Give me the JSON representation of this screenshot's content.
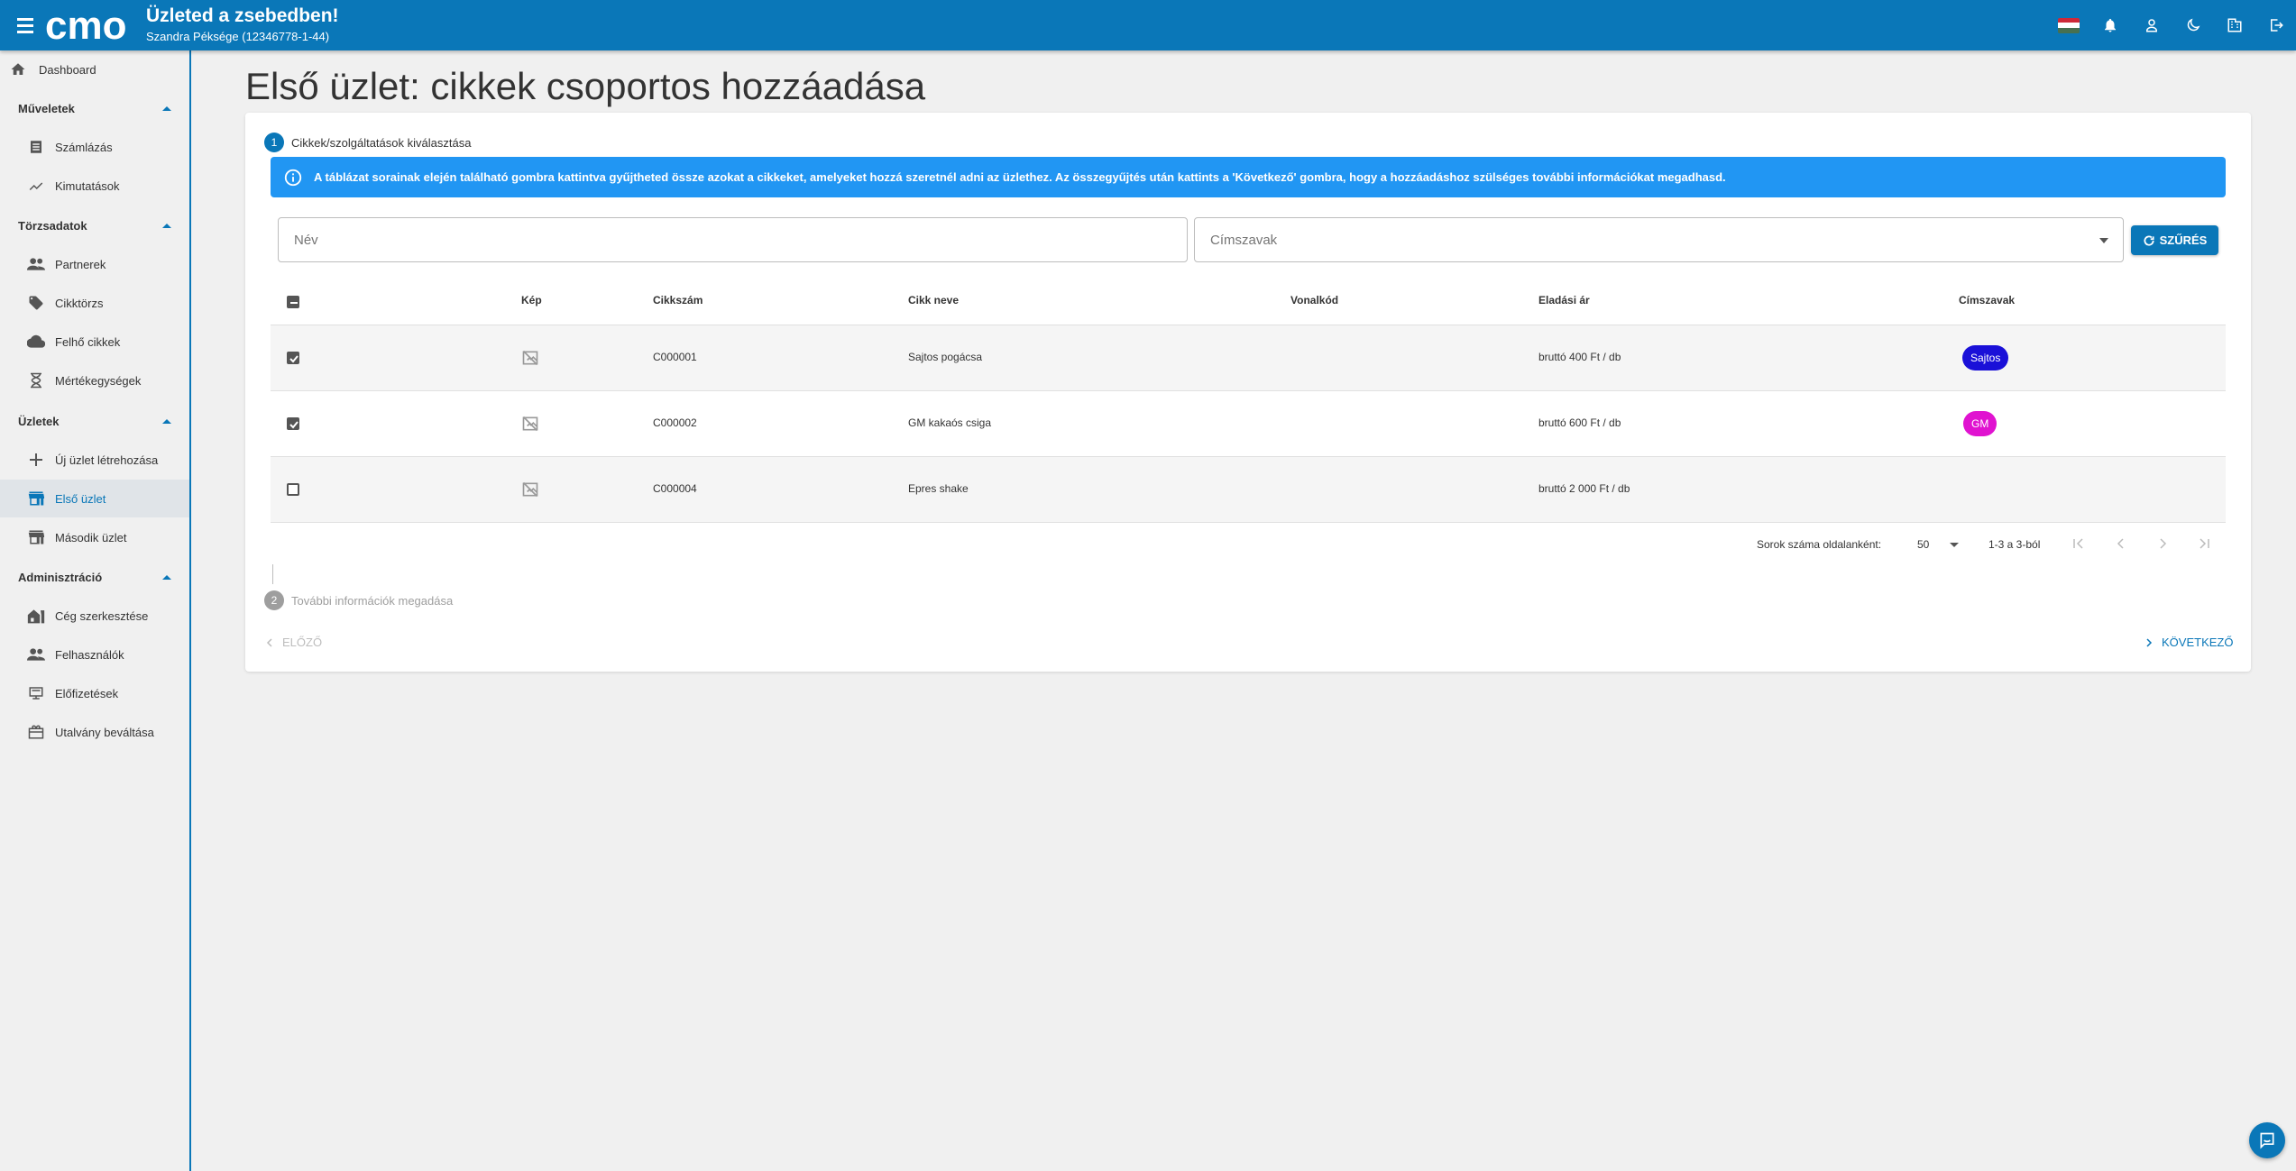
{
  "header": {
    "logo_text": "cmo",
    "title": "Üzleted a zsebedben!",
    "subtitle": "Szandra Péksége (12346778-1-44)",
    "icons": [
      "hungarian-flag",
      "bell-icon",
      "account-icon",
      "dark-mode-icon",
      "company-icon",
      "logout-icon"
    ],
    "flag_colors": [
      "#ce2939",
      "#ffffff",
      "#477050"
    ]
  },
  "sidebar": {
    "dashboard": "Dashboard",
    "sections": [
      {
        "title": "Műveletek",
        "items": [
          "Számlázás",
          "Kimutatások"
        ]
      },
      {
        "title": "Törzsadatok",
        "items": [
          "Partnerek",
          "Cikktörzs",
          "Felhő cikkek",
          "Mértékegységek"
        ]
      },
      {
        "title": "Üzletek",
        "items": [
          "Új üzlet létrehozása",
          "Első üzlet",
          "Második üzlet"
        ]
      },
      {
        "title": "Adminisztráció",
        "items": [
          "Cég szerkesztése",
          "Felhasználók",
          "Előfizetések",
          "Utalvány beváltása"
        ]
      }
    ],
    "active_item": "Első üzlet"
  },
  "page": {
    "title": "Első üzlet: cikkek csoportos hozzáadása"
  },
  "stepper": {
    "step1": {
      "number": "1",
      "label": "Cikkek/szolgáltatások kiválasztása"
    },
    "step2": {
      "number": "2",
      "label": "További információk megadása"
    }
  },
  "info": {
    "text": "A táblázat sorainak elején található gombra kattintva gyűjtheted össze azokat a cikkeket, amelyeket hozzá szeretnél adni az üzlethez. Az összegyűjtés után kattints a 'Következő' gombra, hogy a hozzáadáshoz szülséges további információkat megadhasd."
  },
  "filters": {
    "name_placeholder": "Név",
    "tags_placeholder": "Címszavak",
    "filter_button": "SZŰRÉS"
  },
  "table": {
    "columns": [
      "Kép",
      "Cikkszám",
      "Cikk neve",
      "Vonalkód",
      "Eladási ár",
      "Címszavak"
    ],
    "rows": [
      {
        "checked": true,
        "sku": "C000001",
        "name": "Sajtos pogácsa",
        "barcode": "",
        "price": "bruttó 400 Ft / db",
        "tag": "Sajtos",
        "tag_color": "#1a10d8"
      },
      {
        "checked": true,
        "sku": "C000002",
        "name": "GM kakaós csiga",
        "barcode": "",
        "price": "bruttó 600 Ft / db",
        "tag": "GM",
        "tag_color": "#e013d0"
      },
      {
        "checked": false,
        "sku": "C000004",
        "name": "Epres shake",
        "barcode": "",
        "price": "bruttó 2 000 Ft / db",
        "tag": "",
        "tag_color": ""
      }
    ]
  },
  "pagination": {
    "rows_per_page_label": "Sorok száma oldalanként:",
    "rows_per_page": "50",
    "range": "1-3 a 3-ból"
  },
  "navigation": {
    "prev": "ELŐZŐ",
    "next": "KÖVETKEZŐ"
  },
  "colors": {
    "primary": "#0a77b8",
    "info": "#2196f3",
    "step_inactive": "#9e9e9e"
  }
}
